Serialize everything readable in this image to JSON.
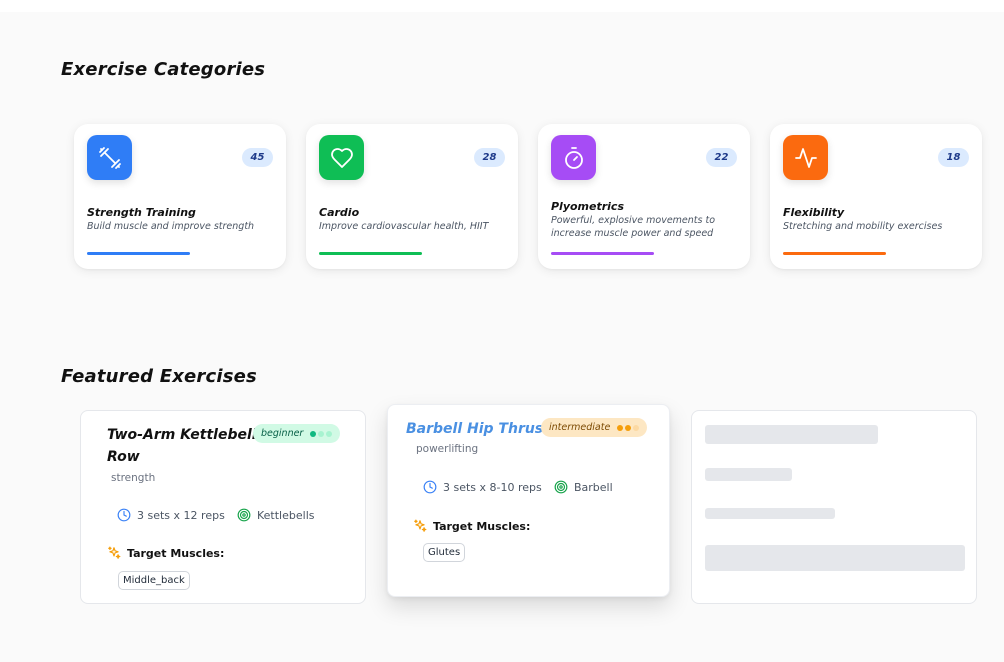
{
  "sections": {
    "categories_title": "Exercise Categories",
    "featured_title": "Featured Exercises"
  },
  "categories": [
    {
      "name": "Strength Training",
      "description": "Build muscle and improve strength",
      "count": "45",
      "color": "#2f7df6",
      "icon": "dumbbell-icon",
      "progress": 0.55
    },
    {
      "name": "Cardio",
      "description": "Improve cardiovascular health, HIIT",
      "count": "28",
      "color": "#0fbe55",
      "icon": "heart-icon",
      "progress": 0.55
    },
    {
      "name": "Plyometrics",
      "description": "Powerful, explosive movements to increase muscle power and speed",
      "count": "22",
      "color": "#a64cf5",
      "icon": "stopwatch-icon",
      "progress": 0.55
    },
    {
      "name": "Flexibility",
      "description": "Stretching and mobility exercises",
      "count": "18",
      "color": "#fb6a0f",
      "icon": "activity-pulse-icon",
      "progress": 0.55
    }
  ],
  "featured": [
    {
      "title": "Two-Arm Kettlebell Row",
      "category": "strength",
      "level": "beginner",
      "level_filled": 1,
      "sets": "3 sets x 12 reps",
      "equipment": "Kettlebells",
      "target_label": "Target Muscles:",
      "muscles": [
        "Middle_back"
      ]
    },
    {
      "title": "Barbell Hip Thrust",
      "category": "powerlifting",
      "level": "intermediate",
      "level_filled": 2,
      "sets": "3 sets x 8-10 reps",
      "equipment": "Barbell",
      "target_label": "Target Muscles:",
      "muscles": [
        "Glutes"
      ]
    }
  ],
  "colors": {
    "beginner_bg": "#d1fae5",
    "intermediate_bg": "#fde7c3",
    "title_accent": "#4a90e2"
  }
}
